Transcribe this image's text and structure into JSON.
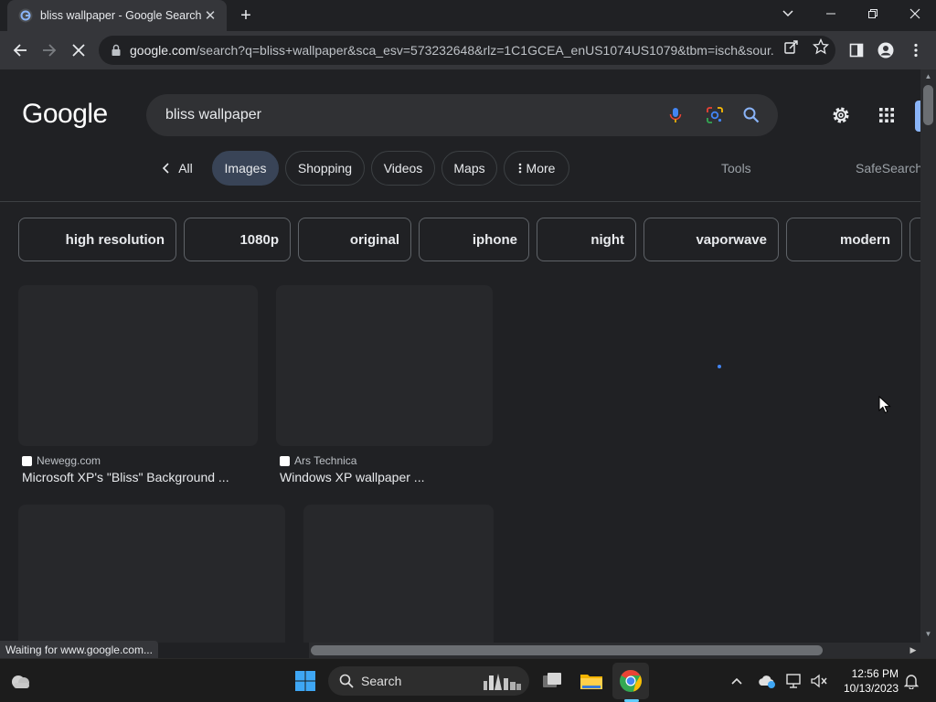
{
  "browser": {
    "tab_title": "bliss wallpaper - Google Search",
    "tab_close": "✕",
    "new_tab": "+",
    "url_host": "google.com",
    "url_path": "/search?q=bliss+wallpaper&sca_esv=573232648&rlz=1C1GCEA_enUS1074US1079&tbm=isch&sour..."
  },
  "google": {
    "logo": "Google",
    "query": "bliss wallpaper",
    "nav_tabs": [
      {
        "label": "All"
      },
      {
        "label": "Images"
      },
      {
        "label": "Shopping"
      },
      {
        "label": "Videos"
      },
      {
        "label": "Maps"
      },
      {
        "label": "More"
      }
    ],
    "tools": "Tools",
    "safesearch": "SafeSearch",
    "chips": [
      "high resolution",
      "1080p",
      "original",
      "iphone",
      "night",
      "vaporwave",
      "modern"
    ],
    "results": [
      {
        "source": "Newegg.com",
        "caption": "Microsoft XP's \"Bliss\" Background ..."
      },
      {
        "source": "Ars Technica",
        "caption": "Windows XP wallpaper ..."
      }
    ]
  },
  "status_text": "Waiting for www.google.com...",
  "taskbar": {
    "search_label": "Search",
    "time": "12:56 PM",
    "date": "10/13/2023"
  },
  "colors": {
    "accent_blue": "#8ab4f8",
    "active_tab_bg": "#394457",
    "page_bg": "#202124"
  }
}
